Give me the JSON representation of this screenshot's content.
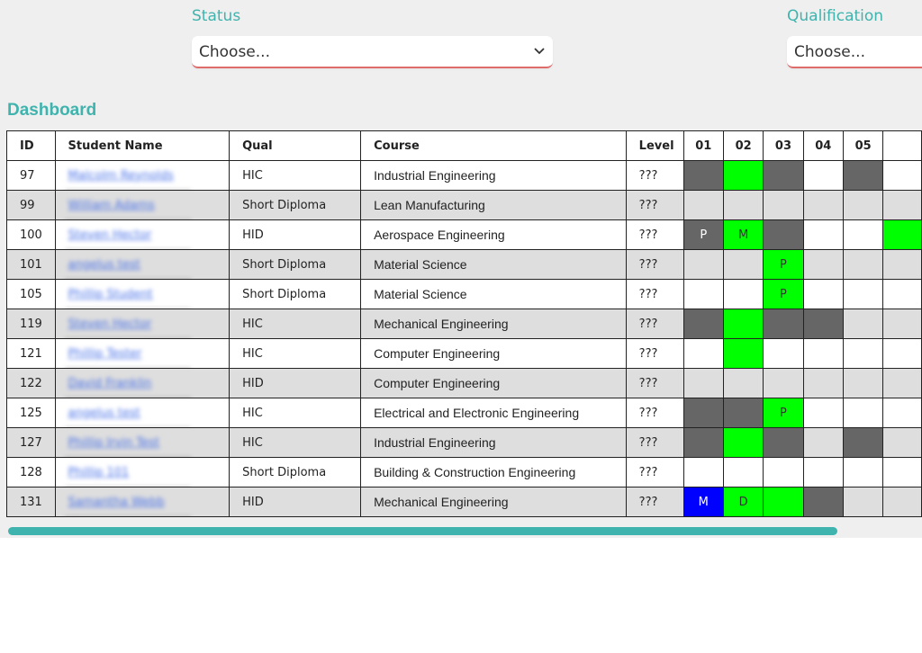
{
  "filters": {
    "status": {
      "label": "Status",
      "value": "Choose..."
    },
    "qualification": {
      "label": "Qualification",
      "value": "Choose..."
    }
  },
  "dashboard": {
    "title": "Dashboard",
    "columns": {
      "id": "ID",
      "name": "Student Name",
      "qual": "Qual",
      "course": "Course",
      "level": "Level"
    },
    "units": [
      "01",
      "02",
      "03",
      "04",
      "05"
    ],
    "rows": [
      {
        "id": "97",
        "name": "Malcolm Reynolds",
        "qual": "HIC",
        "course": "Industrial Engineering",
        "level": "???",
        "cells": [
          {
            "s": "dark",
            "t": ""
          },
          {
            "s": "green",
            "t": ""
          },
          {
            "s": "dark",
            "t": ""
          },
          {
            "s": "",
            "t": ""
          },
          {
            "s": "dark",
            "t": ""
          }
        ]
      },
      {
        "id": "99",
        "name": "William Adams",
        "qual": "Short Diploma",
        "course": "Lean Manufacturing",
        "level": "???",
        "cells": [
          {
            "s": "",
            "t": ""
          },
          {
            "s": "",
            "t": ""
          },
          {
            "s": "",
            "t": ""
          },
          {
            "s": "",
            "t": ""
          },
          {
            "s": "",
            "t": ""
          }
        ]
      },
      {
        "id": "100",
        "name": "Steven Hector",
        "qual": "HID",
        "course": "Aerospace Engineering",
        "level": "???",
        "cells": [
          {
            "s": "dark",
            "t": "P"
          },
          {
            "s": "green",
            "t": "M"
          },
          {
            "s": "dark",
            "t": ""
          },
          {
            "s": "",
            "t": ""
          },
          {
            "s": "",
            "t": ""
          }
        ]
      },
      {
        "id": "101",
        "name": "angelus test",
        "qual": "Short Diploma",
        "course": "Material Science",
        "level": "???",
        "cells": [
          {
            "s": "",
            "t": ""
          },
          {
            "s": "",
            "t": ""
          },
          {
            "s": "green",
            "t": "P"
          },
          {
            "s": "",
            "t": ""
          },
          {
            "s": "",
            "t": ""
          }
        ]
      },
      {
        "id": "105",
        "name": "Phillip Student",
        "qual": "Short Diploma",
        "course": "Material Science",
        "level": "???",
        "cells": [
          {
            "s": "",
            "t": ""
          },
          {
            "s": "",
            "t": ""
          },
          {
            "s": "green",
            "t": "P"
          },
          {
            "s": "",
            "t": ""
          },
          {
            "s": "",
            "t": ""
          }
        ]
      },
      {
        "id": "119",
        "name": "Steven Hector",
        "qual": "HIC",
        "course": "Mechanical Engineering",
        "level": "???",
        "cells": [
          {
            "s": "dark",
            "t": ""
          },
          {
            "s": "green",
            "t": ""
          },
          {
            "s": "dark",
            "t": ""
          },
          {
            "s": "dark",
            "t": ""
          },
          {
            "s": "",
            "t": ""
          }
        ]
      },
      {
        "id": "121",
        "name": "Phillip Tester",
        "qual": "HIC",
        "course": "Computer Engineering",
        "level": "???",
        "cells": [
          {
            "s": "",
            "t": ""
          },
          {
            "s": "green",
            "t": ""
          },
          {
            "s": "",
            "t": ""
          },
          {
            "s": "",
            "t": ""
          },
          {
            "s": "",
            "t": ""
          }
        ]
      },
      {
        "id": "122",
        "name": "David Franklin",
        "qual": "HID",
        "course": "Computer Engineering",
        "level": "???",
        "cells": [
          {
            "s": "",
            "t": ""
          },
          {
            "s": "",
            "t": ""
          },
          {
            "s": "",
            "t": ""
          },
          {
            "s": "",
            "t": ""
          },
          {
            "s": "",
            "t": ""
          }
        ]
      },
      {
        "id": "125",
        "name": "angelus test",
        "qual": "HIC",
        "course": "Electrical and Electronic Engineering",
        "level": "???",
        "cells": [
          {
            "s": "dark",
            "t": ""
          },
          {
            "s": "dark",
            "t": ""
          },
          {
            "s": "green",
            "t": "P"
          },
          {
            "s": "",
            "t": ""
          },
          {
            "s": "",
            "t": ""
          }
        ]
      },
      {
        "id": "127",
        "name": "Phillip Irvin Test",
        "qual": "HIC",
        "course": "Industrial Engineering",
        "level": "???",
        "cells": [
          {
            "s": "dark",
            "t": ""
          },
          {
            "s": "green",
            "t": ""
          },
          {
            "s": "dark",
            "t": ""
          },
          {
            "s": "",
            "t": ""
          },
          {
            "s": "dark",
            "t": ""
          }
        ]
      },
      {
        "id": "128",
        "name": "Phillip 101",
        "qual": "Short Diploma",
        "course": "Building & Construction Engineering",
        "level": "???",
        "cells": [
          {
            "s": "",
            "t": ""
          },
          {
            "s": "",
            "t": ""
          },
          {
            "s": "",
            "t": ""
          },
          {
            "s": "",
            "t": ""
          },
          {
            "s": "",
            "t": ""
          }
        ]
      },
      {
        "id": "131",
        "name": "Samantha Webb",
        "qual": "HID",
        "course": "Mechanical Engineering",
        "level": "???",
        "cells": [
          {
            "s": "blue",
            "t": "M"
          },
          {
            "s": "green",
            "t": "D"
          },
          {
            "s": "green",
            "t": ""
          },
          {
            "s": "dark",
            "t": ""
          },
          {
            "s": "",
            "t": ""
          }
        ]
      }
    ]
  },
  "colors": {
    "accent": "#3fb3ad",
    "underline": "#e06b6b",
    "dark_cell": "#666666",
    "green_cell": "#00ff00",
    "blue_cell": "#0000ff"
  },
  "icons": {
    "select_chevron": "chevron-down-icon"
  }
}
